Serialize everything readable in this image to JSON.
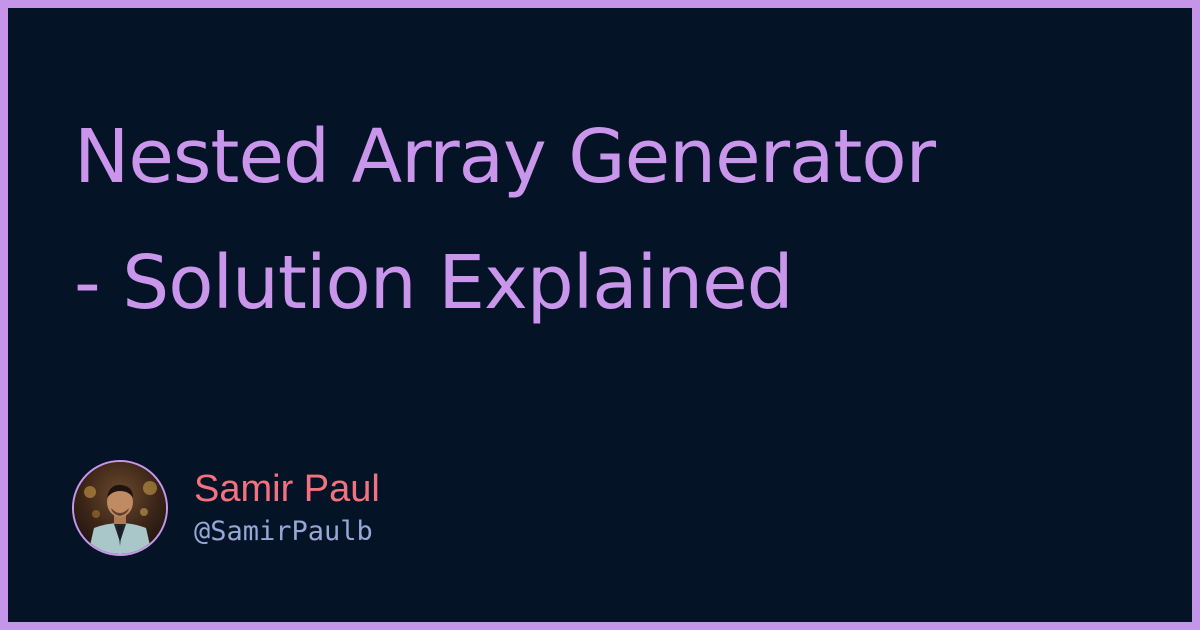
{
  "colors": {
    "frame": "#c595ea",
    "background": "#051326",
    "title": "#c996ec",
    "author_name": "#f2737f",
    "author_handle": "#96a8d6"
  },
  "title": {
    "line1": "Nested Array Generator",
    "line2": "- Solution Explained"
  },
  "author": {
    "name": "Samir Paul",
    "handle": "@SamirPaulb",
    "avatar_icon": "author-photo"
  }
}
